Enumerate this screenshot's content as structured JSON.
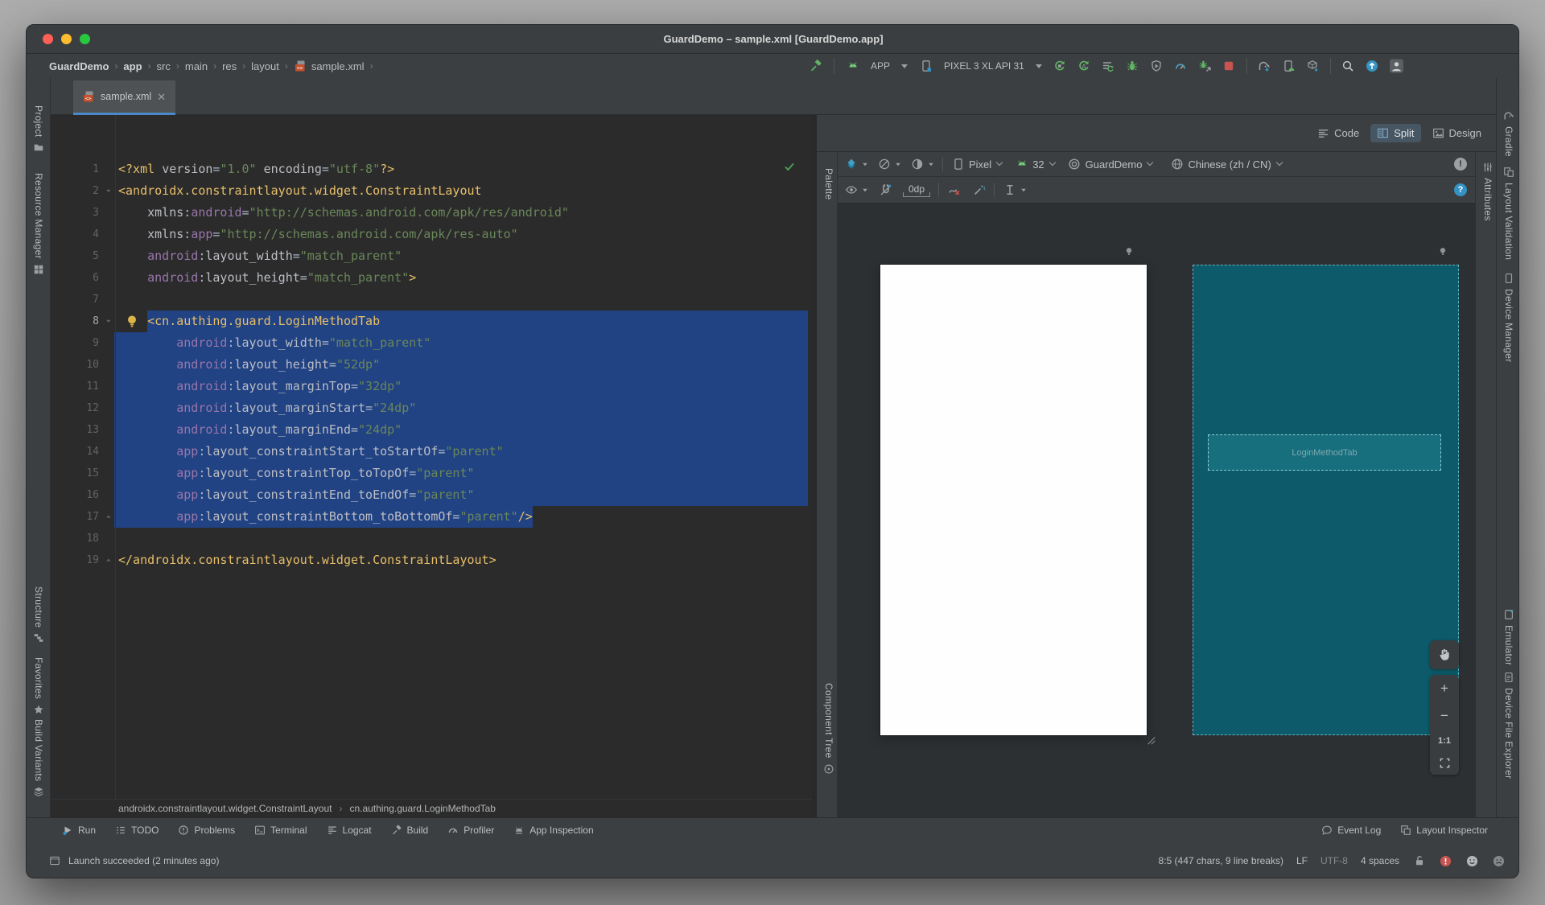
{
  "window": {
    "title": "GuardDemo – sample.xml [GuardDemo.app]"
  },
  "breadcrumbs": {
    "items": [
      "GuardDemo",
      "app",
      "src",
      "main",
      "res",
      "layout",
      "sample.xml"
    ],
    "separator": "›"
  },
  "toolbar": {
    "run_config": "APP",
    "device": "PIXEL 3 XL API 31",
    "actions": [
      "rerun",
      "apply-code-changes",
      "run-tasks",
      "debug",
      "run-with-coverage",
      "profile",
      "attach-debugger",
      "stop",
      "gradle-sync",
      "device-manager",
      "sdk-manager",
      "search-everywhere",
      "updates",
      "profile-avatar"
    ]
  },
  "tab": {
    "label": "sample.xml"
  },
  "left_strip": [
    {
      "label": "Project",
      "icon": "project-icon"
    },
    {
      "label": "Resource Manager",
      "icon": "resource-manager-icon"
    },
    {
      "label": "Structure",
      "icon": "structure-icon"
    },
    {
      "label": "Favorites",
      "icon": "favorites-icon"
    },
    {
      "label": "Build Variants",
      "icon": "build-variants-icon"
    }
  ],
  "right_strip": [
    {
      "label": "Gradle",
      "icon": "gradle-icon"
    },
    {
      "label": "Layout Validation",
      "icon": "layout-validation-icon"
    },
    {
      "label": "Device Manager",
      "icon": "device-manager-strip-icon"
    },
    {
      "label": "Emulator",
      "icon": "emulator-icon"
    },
    {
      "label": "Device File Explorer",
      "icon": "device-file-explorer-icon"
    }
  ],
  "attributes_tab": {
    "label": "Attributes"
  },
  "design": {
    "modes": [
      {
        "label": "Code",
        "icon": "code-mode-icon",
        "active": false
      },
      {
        "label": "Split",
        "icon": "split-mode-icon",
        "active": true
      },
      {
        "label": "Design",
        "icon": "design-mode-icon",
        "active": false
      }
    ],
    "device": "Pixel",
    "api_level": "32",
    "theme": "GuardDemo",
    "locale": "Chinese (zh / CN)",
    "default_margin": "0dp",
    "palette_label": "Palette",
    "component_tree_label": "Component Tree",
    "error_badge": "!",
    "help_badge": "?",
    "blueprint_widget_label": "LoginMethodTab",
    "zoom": {
      "plus": "+",
      "minus": "−",
      "ratio": "1:1"
    }
  },
  "editor": {
    "lines": [
      {
        "n": "1",
        "seg": [
          [
            "t",
            "<?xml "
          ],
          [
            "a",
            "version"
          ],
          [
            "p",
            "="
          ],
          [
            "s",
            "\"1.0\""
          ],
          [
            "p",
            " "
          ],
          [
            "a",
            "encoding"
          ],
          [
            "p",
            "="
          ],
          [
            "s",
            "\"utf-8\""
          ],
          [
            "t",
            "?>"
          ]
        ]
      },
      {
        "n": "2",
        "fold": "d",
        "seg": [
          [
            "t",
            "<androidx.constraintlayout.widget.ConstraintLayout"
          ]
        ]
      },
      {
        "n": "3",
        "seg": [
          [
            "p",
            "    "
          ],
          [
            "a",
            "xmlns"
          ],
          [
            "p",
            ":"
          ],
          [
            "n",
            "android"
          ],
          [
            "p",
            "="
          ],
          [
            "s",
            "\"http://schemas.android.com/apk/res/android\""
          ]
        ]
      },
      {
        "n": "4",
        "seg": [
          [
            "p",
            "    "
          ],
          [
            "a",
            "xmlns"
          ],
          [
            "p",
            ":"
          ],
          [
            "n",
            "app"
          ],
          [
            "p",
            "="
          ],
          [
            "s",
            "\"http://schemas.android.com/apk/res-auto\""
          ]
        ]
      },
      {
        "n": "5",
        "seg": [
          [
            "p",
            "    "
          ],
          [
            "n",
            "android"
          ],
          [
            "p",
            ":"
          ],
          [
            "a",
            "layout_width"
          ],
          [
            "p",
            "="
          ],
          [
            "s",
            "\"match_parent\""
          ]
        ]
      },
      {
        "n": "6",
        "seg": [
          [
            "p",
            "    "
          ],
          [
            "n",
            "android"
          ],
          [
            "p",
            ":"
          ],
          [
            "a",
            "layout_height"
          ],
          [
            "p",
            "="
          ],
          [
            "s",
            "\"match_parent\""
          ],
          [
            "t",
            ">"
          ]
        ]
      },
      {
        "n": "7",
        "seg": []
      },
      {
        "n": "8",
        "fold": "d",
        "bulb": true,
        "hl": true,
        "seg": [
          [
            "p",
            "    "
          ],
          [
            "t",
            "<cn.authing.guard.LoginMethodTab"
          ]
        ]
      },
      {
        "n": "9",
        "seg": [
          [
            "p",
            "        "
          ],
          [
            "n",
            "android"
          ],
          [
            "p",
            ":"
          ],
          [
            "a",
            "layout_width"
          ],
          [
            "p",
            "="
          ],
          [
            "s",
            "\"match_parent\""
          ]
        ]
      },
      {
        "n": "10",
        "seg": [
          [
            "p",
            "        "
          ],
          [
            "n",
            "android"
          ],
          [
            "p",
            ":"
          ],
          [
            "a",
            "layout_height"
          ],
          [
            "p",
            "="
          ],
          [
            "s",
            "\"52dp\""
          ]
        ]
      },
      {
        "n": "11",
        "seg": [
          [
            "p",
            "        "
          ],
          [
            "n",
            "android"
          ],
          [
            "p",
            ":"
          ],
          [
            "a",
            "layout_marginTop"
          ],
          [
            "p",
            "="
          ],
          [
            "s",
            "\"32dp\""
          ]
        ]
      },
      {
        "n": "12",
        "seg": [
          [
            "p",
            "        "
          ],
          [
            "n",
            "android"
          ],
          [
            "p",
            ":"
          ],
          [
            "a",
            "layout_marginStart"
          ],
          [
            "p",
            "="
          ],
          [
            "s",
            "\"24dp\""
          ]
        ]
      },
      {
        "n": "13",
        "seg": [
          [
            "p",
            "        "
          ],
          [
            "n",
            "android"
          ],
          [
            "p",
            ":"
          ],
          [
            "a",
            "layout_marginEnd"
          ],
          [
            "p",
            "="
          ],
          [
            "s",
            "\"24dp\""
          ]
        ]
      },
      {
        "n": "14",
        "seg": [
          [
            "p",
            "        "
          ],
          [
            "n",
            "app"
          ],
          [
            "p",
            ":"
          ],
          [
            "a",
            "layout_constraintStart_toStartOf"
          ],
          [
            "p",
            "="
          ],
          [
            "s",
            "\"parent\""
          ]
        ]
      },
      {
        "n": "15",
        "seg": [
          [
            "p",
            "        "
          ],
          [
            "n",
            "app"
          ],
          [
            "p",
            ":"
          ],
          [
            "a",
            "layout_constraintTop_toTopOf"
          ],
          [
            "p",
            "="
          ],
          [
            "s",
            "\"parent\""
          ]
        ]
      },
      {
        "n": "16",
        "seg": [
          [
            "p",
            "        "
          ],
          [
            "n",
            "app"
          ],
          [
            "p",
            ":"
          ],
          [
            "a",
            "layout_constraintEnd_toEndOf"
          ],
          [
            "p",
            "="
          ],
          [
            "s",
            "\"parent\""
          ]
        ]
      },
      {
        "n": "17",
        "fold": "u",
        "seg": [
          [
            "p",
            "        "
          ],
          [
            "n",
            "app"
          ],
          [
            "p",
            ":"
          ],
          [
            "a",
            "layout_constraintBottom_toBottomOf"
          ],
          [
            "p",
            "="
          ],
          [
            "s",
            "\"parent\""
          ],
          [
            "t",
            "/>"
          ]
        ]
      },
      {
        "n": "18",
        "seg": []
      },
      {
        "n": "19",
        "fold": "u",
        "seg": [
          [
            "t",
            "</androidx.constraintlayout.widget.ConstraintLayout>"
          ]
        ]
      }
    ]
  },
  "bottom": {
    "xml_breadcrumb": [
      "androidx.constraintlayout.widget.ConstraintLayout",
      "cn.authing.guard.LoginMethodTab"
    ],
    "tools_left": [
      {
        "label": "Run",
        "icon": "run-icon"
      },
      {
        "label": "TODO",
        "icon": "todo-icon"
      },
      {
        "label": "Problems",
        "icon": "problems-icon"
      },
      {
        "label": "Terminal",
        "icon": "terminal-icon"
      },
      {
        "label": "Logcat",
        "icon": "logcat-icon"
      },
      {
        "label": "Build",
        "icon": "build-icon"
      },
      {
        "label": "Profiler",
        "icon": "profiler-icon"
      },
      {
        "label": "App Inspection",
        "icon": "app-inspection-icon"
      }
    ],
    "tools_right": [
      {
        "label": "Event Log",
        "icon": "event-log-icon"
      },
      {
        "label": "Layout Inspector",
        "icon": "layout-inspector-icon"
      }
    ],
    "status_message": "Launch succeeded (2 minutes ago)",
    "caret_position": "8:5 (447 chars, 9 line breaks)",
    "line_separator": "LF",
    "encoding": "UTF-8",
    "indent": "4 spaces"
  },
  "colors": {
    "selection": "#214283",
    "tag": "#e8bf6a",
    "namespace": "#9876aa",
    "attribute": "#bcbec4",
    "string": "#6a8759",
    "accent_blue": "#4a88c7",
    "blueprint_bg": "#0d5b6a",
    "stop_red": "#c75450",
    "run_green": "#5fb365"
  }
}
